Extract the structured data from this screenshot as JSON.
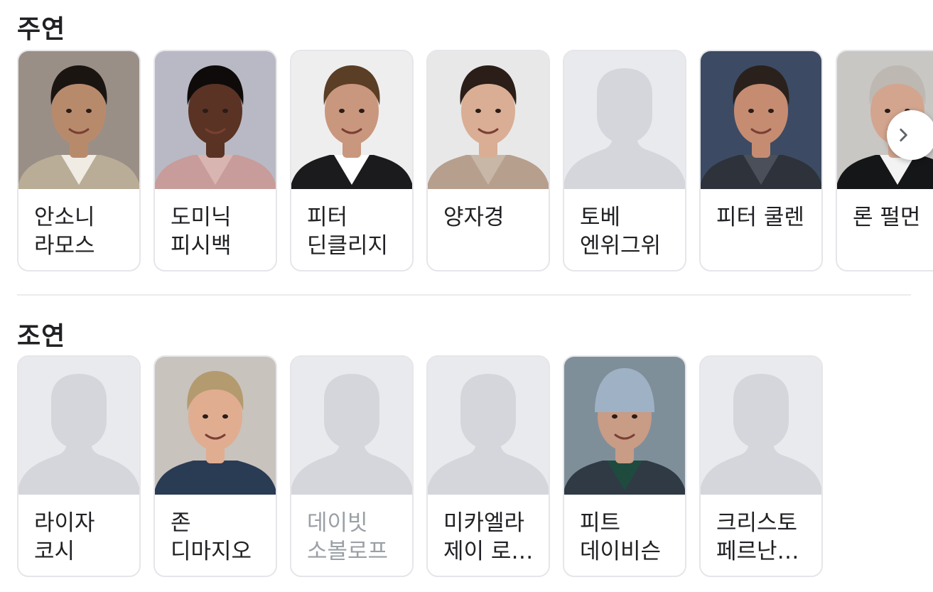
{
  "sections": {
    "lead": {
      "title": "주연",
      "cast": [
        {
          "name": "안소니 라모스",
          "photo": "actor-photo",
          "bg": "#9a8f86",
          "skin": "#b88a6c",
          "hair": "#1b1512",
          "shirt": "#f0ece4",
          "jacket": "#b9ad97"
        },
        {
          "name": "도미닉 피시백",
          "photo": "actor-photo",
          "bg": "#b8b9c4",
          "skin": "#5a3324",
          "hair": "#0f0b0a",
          "shirt": "#d9b5b2",
          "jacket": "#c89c9a"
        },
        {
          "name": "피터 딘클리지",
          "photo": "actor-photo",
          "bg": "#efeeee",
          "skin": "#c9977d",
          "hair": "#5a3e25",
          "shirt": "#ffffff",
          "jacket": "#1b1b1d"
        },
        {
          "name": "양자경",
          "photo": "actor-photo",
          "bg": "#e8e8e8",
          "skin": "#d9ae94",
          "hair": "#2b1d17",
          "shirt": "#c8b7a6",
          "jacket": "#b79f8e"
        },
        {
          "name": "토베 엔위그위",
          "photo": "placeholder-silhouette"
        },
        {
          "name": "피터 쿨렌",
          "photo": "actor-photo",
          "bg": "#3c4b63",
          "skin": "#c58c72",
          "hair": "#2a211d",
          "shirt": "#4b4f59",
          "jacket": "#2e323b"
        },
        {
          "name": "론 펄먼",
          "photo": "actor-photo",
          "bg": "#c9c7c4",
          "skin": "#d3a58f",
          "hair": "#bdb8b2",
          "shirt": "#f3f3f3",
          "jacket": "#151617"
        }
      ]
    },
    "support": {
      "title": "조연",
      "cast": [
        {
          "name": "라이자 코시",
          "photo": "placeholder-silhouette"
        },
        {
          "name": "존 디마지오",
          "photo": "actor-photo",
          "bg": "#c8c3bd",
          "skin": "#e0ad91",
          "hair": "#b49a6f",
          "shirt": "#2a3b54",
          "jacket": "#2a3b54"
        },
        {
          "name": "데이빗 소볼로프",
          "photo": "placeholder-silhouette",
          "faded": true
        },
        {
          "name": "미카엘라 제이 로…",
          "photo": "placeholder-silhouette"
        },
        {
          "name": "피트 데이비슨",
          "photo": "actor-photo",
          "bg": "#7f8f9a",
          "skin": "#c99c85",
          "hair": "#1d2a3a",
          "shirt": "#1f4b3f",
          "jacket": "#2f3a45",
          "hat": "#9fb1c4"
        },
        {
          "name": "크리스토 페르난…",
          "photo": "placeholder-silhouette"
        }
      ]
    }
  },
  "carousel": {
    "next_icon": "chevron-right-icon"
  },
  "colors": {
    "placeholder_bg": "#e9eaee",
    "placeholder_figure": "#d5d6dc",
    "card_border": "#e6e6ea",
    "text": "#202124",
    "text_faded": "#9aa0a6"
  }
}
